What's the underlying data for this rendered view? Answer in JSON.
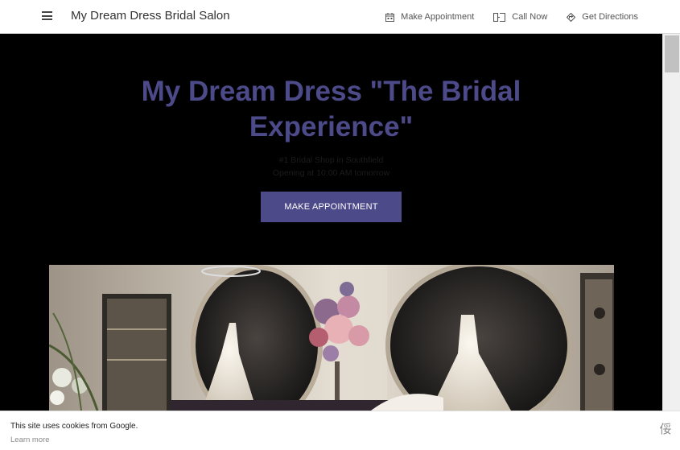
{
  "header": {
    "site_title": "My Dream Dress Bridal Salon",
    "nav": [
      {
        "label": "Make Appointment",
        "icon": "calendar-icon"
      },
      {
        "label": "Call Now",
        "icon": "phone-icon"
      },
      {
        "label": "Get Directions",
        "icon": "directions-icon"
      }
    ]
  },
  "hero": {
    "title": "My Dream Dress \"The Bridal Experience\"",
    "tagline": "#1 Bridal Shop in Southfield",
    "hours": "Opening at 10:00 AM tomorrow",
    "cta_label": "MAKE APPOINTMENT"
  },
  "cookie": {
    "text": "This site uses cookies from Google.",
    "learn_more": "Learn more",
    "close_glyph": "俀"
  },
  "colors": {
    "accent": "#4d4a8a",
    "background": "#000000",
    "header": "#ffffff"
  }
}
